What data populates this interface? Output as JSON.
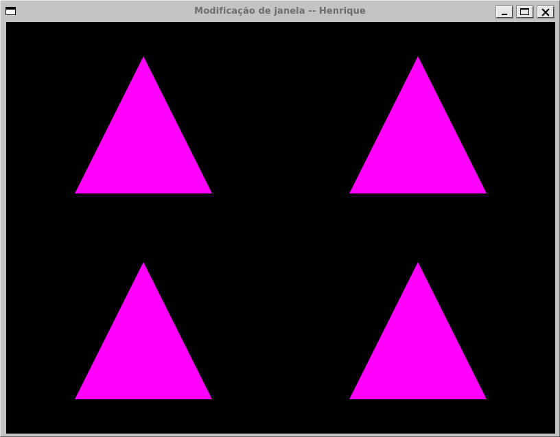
{
  "window": {
    "title": "Modificação de janela -- Henrique"
  },
  "titlebar_buttons": {
    "menu": "window-menu-icon",
    "minimize": "minimize-icon",
    "maximize": "maximize-icon",
    "close": "close-icon"
  },
  "canvas": {
    "background_color": "#000000",
    "shape_color": "#ff00ff",
    "shapes": [
      {
        "name": "triangle-top-left",
        "kind": "triangle"
      },
      {
        "name": "triangle-top-right",
        "kind": "triangle"
      },
      {
        "name": "triangle-bottom-left",
        "kind": "triangle"
      },
      {
        "name": "triangle-bottom-right",
        "kind": "triangle"
      }
    ]
  }
}
